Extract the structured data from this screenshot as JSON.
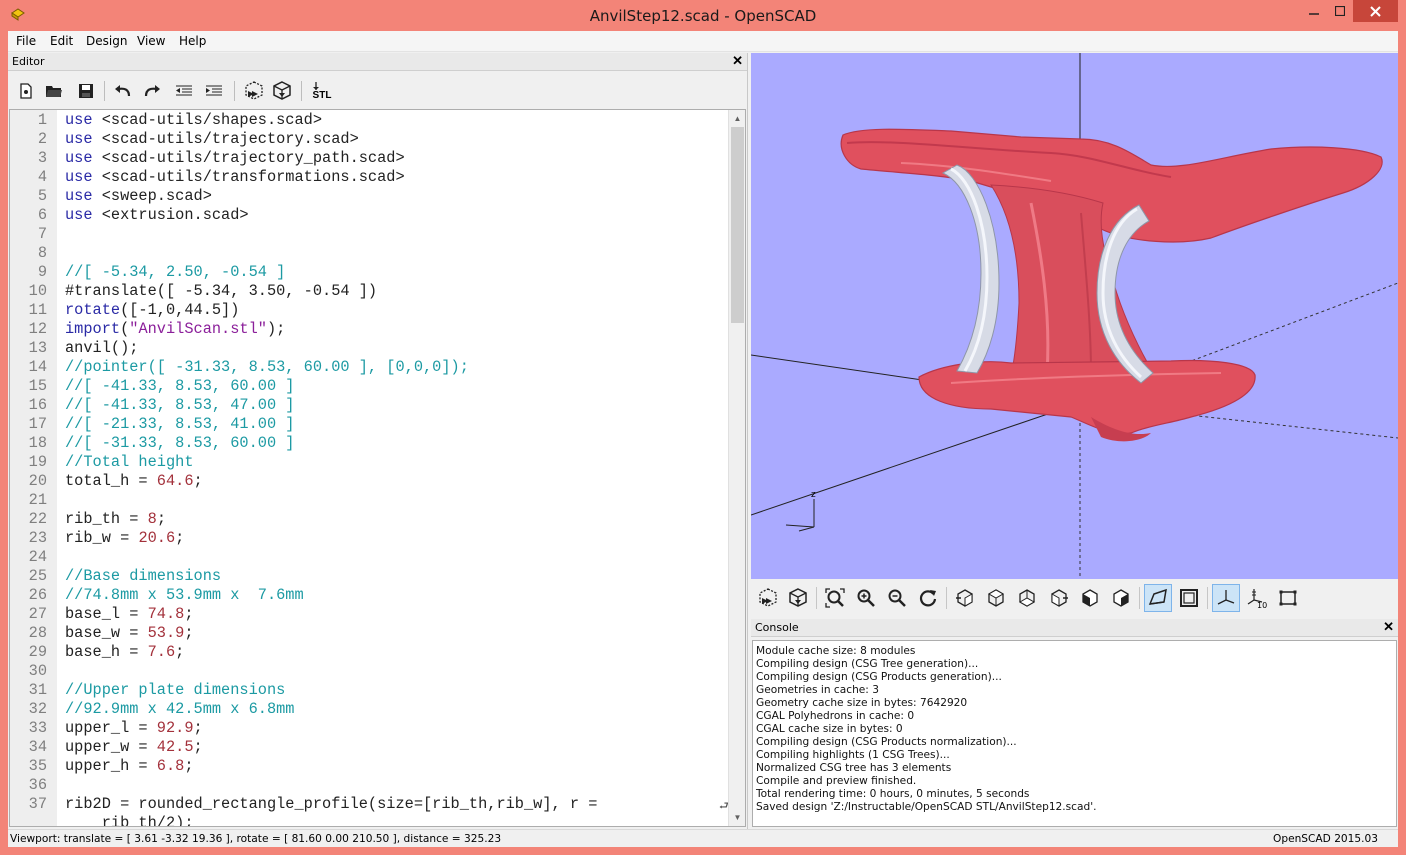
{
  "window": {
    "title": "AnvilStep12.scad - OpenSCAD",
    "minimize_icon": "minimize-icon",
    "maximize_icon": "maximize-icon",
    "close_icon": "close-icon"
  },
  "menu": [
    "File",
    "Edit",
    "Design",
    "View",
    "Help"
  ],
  "editor": {
    "title": "Editor",
    "toolbar": [
      {
        "name": "new-file-button",
        "icon": "new-file-icon"
      },
      {
        "name": "open-file-button",
        "icon": "folder-icon"
      },
      {
        "name": "save-button",
        "icon": "floppy-icon"
      },
      {
        "name": "undo-button",
        "icon": "undo-icon"
      },
      {
        "name": "redo-button",
        "icon": "redo-icon"
      },
      {
        "name": "unindent-button",
        "icon": "unindent-icon"
      },
      {
        "name": "indent-button",
        "icon": "indent-icon"
      },
      {
        "name": "preview-button",
        "icon": "preview-icon"
      },
      {
        "name": "render-button",
        "icon": "render-icon"
      },
      {
        "name": "export-stl-button",
        "icon": "stl-icon",
        "label": "STL"
      }
    ],
    "lines": [
      {
        "n": "1",
        "t": [
          [
            "kw",
            "use "
          ],
          [
            "def",
            "<scad-utils/shapes.scad>"
          ]
        ]
      },
      {
        "n": "2",
        "t": [
          [
            "kw",
            "use "
          ],
          [
            "def",
            "<scad-utils/trajectory.scad>"
          ]
        ]
      },
      {
        "n": "3",
        "t": [
          [
            "kw",
            "use "
          ],
          [
            "def",
            "<scad-utils/trajectory_path.scad>"
          ]
        ]
      },
      {
        "n": "4",
        "t": [
          [
            "kw",
            "use "
          ],
          [
            "def",
            "<scad-utils/transformations.scad>"
          ]
        ]
      },
      {
        "n": "5",
        "t": [
          [
            "kw",
            "use "
          ],
          [
            "def",
            "<sweep.scad>"
          ]
        ]
      },
      {
        "n": "6",
        "t": [
          [
            "kw",
            "use "
          ],
          [
            "def",
            "<extrusion.scad>"
          ]
        ]
      },
      {
        "n": "7",
        "t": []
      },
      {
        "n": "8",
        "t": []
      },
      {
        "n": "9",
        "t": [
          [
            "cm",
            "//[ -5.34, 2.50, -0.54 ]"
          ]
        ]
      },
      {
        "n": "10",
        "t": [
          [
            "def",
            "#translate([ -5.34, 3.50, -0.54 ])"
          ]
        ]
      },
      {
        "n": "11",
        "t": [
          [
            "kw",
            "rotate"
          ],
          [
            "def",
            "([-1,0,44.5])"
          ]
        ]
      },
      {
        "n": "12",
        "t": [
          [
            "kw",
            "import"
          ],
          [
            "def",
            "("
          ],
          [
            "str",
            "\"AnvilScan.stl\""
          ],
          [
            "def",
            ");"
          ]
        ]
      },
      {
        "n": "13",
        "t": [
          [
            "def",
            "anvil();"
          ]
        ]
      },
      {
        "n": "14",
        "t": [
          [
            "cm",
            "//pointer([ -31.33, 8.53, 60.00 ], [0,0,0]);"
          ]
        ]
      },
      {
        "n": "15",
        "t": [
          [
            "cm",
            "//[ -41.33, 8.53, 60.00 ]"
          ]
        ]
      },
      {
        "n": "16",
        "t": [
          [
            "cm",
            "//[ -41.33, 8.53, 47.00 ]"
          ]
        ]
      },
      {
        "n": "17",
        "t": [
          [
            "cm",
            "//[ -21.33, 8.53, 41.00 ]"
          ]
        ]
      },
      {
        "n": "18",
        "t": [
          [
            "cm",
            "//[ -31.33, 8.53, 60.00 ]"
          ]
        ]
      },
      {
        "n": "19",
        "t": [
          [
            "cm",
            "//Total height"
          ]
        ]
      },
      {
        "n": "20",
        "t": [
          [
            "def",
            "total_h = "
          ],
          [
            "num",
            "64.6"
          ],
          [
            "def",
            ";"
          ]
        ]
      },
      {
        "n": "21",
        "t": []
      },
      {
        "n": "22",
        "t": [
          [
            "def",
            "rib_th = "
          ],
          [
            "num",
            "8"
          ],
          [
            "def",
            ";"
          ]
        ]
      },
      {
        "n": "23",
        "t": [
          [
            "def",
            "rib_w = "
          ],
          [
            "num",
            "20.6"
          ],
          [
            "def",
            ";"
          ]
        ]
      },
      {
        "n": "24",
        "t": []
      },
      {
        "n": "25",
        "t": [
          [
            "cm",
            "//Base dimensions"
          ]
        ]
      },
      {
        "n": "26",
        "t": [
          [
            "cm",
            "//74.8mm x 53.9mm x  7.6mm"
          ]
        ]
      },
      {
        "n": "27",
        "t": [
          [
            "def",
            "base_l = "
          ],
          [
            "num",
            "74.8"
          ],
          [
            "def",
            ";"
          ]
        ]
      },
      {
        "n": "28",
        "t": [
          [
            "def",
            "base_w = "
          ],
          [
            "num",
            "53.9"
          ],
          [
            "def",
            ";"
          ]
        ]
      },
      {
        "n": "29",
        "t": [
          [
            "def",
            "base_h = "
          ],
          [
            "num",
            "7.6"
          ],
          [
            "def",
            ";"
          ]
        ]
      },
      {
        "n": "30",
        "t": []
      },
      {
        "n": "31",
        "t": [
          [
            "cm",
            "//Upper plate dimensions"
          ]
        ]
      },
      {
        "n": "32",
        "t": [
          [
            "cm",
            "//92.9mm x 42.5mm x 6.8mm"
          ]
        ]
      },
      {
        "n": "33",
        "t": [
          [
            "def",
            "upper_l = "
          ],
          [
            "num",
            "92.9"
          ],
          [
            "def",
            ";"
          ]
        ]
      },
      {
        "n": "34",
        "t": [
          [
            "def",
            "upper_w = "
          ],
          [
            "num",
            "42.5"
          ],
          [
            "def",
            ";"
          ]
        ]
      },
      {
        "n": "35",
        "t": [
          [
            "def",
            "upper_h = "
          ],
          [
            "num",
            "6.8"
          ],
          [
            "def",
            ";"
          ]
        ]
      },
      {
        "n": "36",
        "t": []
      },
      {
        "n": "37",
        "t": [
          [
            "def",
            "rib2D = rounded_rectangle_profile(size=[rib_th,rib_w], r ="
          ]
        ]
      },
      {
        "n": "",
        "t": [
          [
            "def",
            "    rib_th/2);"
          ]
        ]
      }
    ]
  },
  "view_toolbar": [
    {
      "name": "view-preview-button",
      "icon": "preview-icon"
    },
    {
      "name": "view-render-button",
      "icon": "render-icon"
    },
    {
      "name": "view-all-button",
      "icon": "zoom-all-icon"
    },
    {
      "name": "zoom-in-button",
      "icon": "zoom-in-icon"
    },
    {
      "name": "zoom-out-button",
      "icon": "zoom-out-icon"
    },
    {
      "name": "reset-view-button",
      "icon": "reset-view-icon"
    },
    {
      "name": "view-right-button",
      "icon": "view-right-icon"
    },
    {
      "name": "view-top-button",
      "icon": "view-top-icon"
    },
    {
      "name": "view-bottom-button",
      "icon": "view-bottom-icon"
    },
    {
      "name": "view-left-button",
      "icon": "view-left-icon"
    },
    {
      "name": "view-front-button",
      "icon": "view-front-icon"
    },
    {
      "name": "view-back-button",
      "icon": "view-back-icon"
    },
    {
      "name": "perspective-button",
      "icon": "perspective-icon"
    },
    {
      "name": "orthogonal-button",
      "icon": "orthogonal-icon"
    },
    {
      "name": "show-axes-button",
      "icon": "axes-icon"
    },
    {
      "name": "show-scale-markers-button",
      "icon": "scale-markers-icon",
      "label": "10"
    },
    {
      "name": "show-edges-button",
      "icon": "edges-icon"
    }
  ],
  "console": {
    "title": "Console",
    "lines": [
      "Module cache size: 8 modules",
      "Compiling design (CSG Tree generation)...",
      "Compiling design (CSG Products generation)...",
      "Geometries in cache: 3",
      "Geometry cache size in bytes: 7642920",
      "CGAL Polyhedrons in cache: 0",
      "CGAL cache size in bytes: 0",
      "Compiling design (CSG Products normalization)...",
      "Compiling highlights (1 CSG Trees)...",
      "Normalized CSG tree has 3 elements",
      "Compile and preview finished.",
      "Total rendering time: 0 hours, 0 minutes, 5 seconds",
      "Saved design 'Z:/Instructable/OpenSCAD STL/AnvilStep12.scad'."
    ]
  },
  "viewport": {
    "axis_label": "z",
    "background": "#aaaaff",
    "model_color": "#e0505e",
    "rib_color": "#d7dbe6"
  },
  "status": {
    "viewport": "Viewport: translate = [ 3.61 -3.32 19.36 ], rotate = [ 81.60 0.00 210.50 ], distance = 325.23",
    "version": "OpenSCAD 2015.03"
  }
}
